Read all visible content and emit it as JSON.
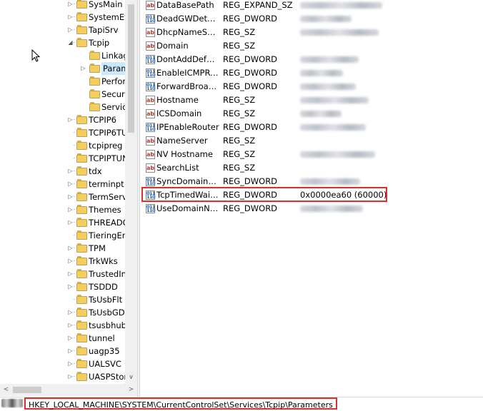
{
  "tree": {
    "items": [
      {
        "label": "SysMain",
        "indent": 0,
        "expander": "collapsed"
      },
      {
        "label": "SystemEve",
        "indent": 0,
        "expander": "collapsed"
      },
      {
        "label": "TapiSrv",
        "indent": 0,
        "expander": "collapsed"
      },
      {
        "label": "Tcpip",
        "indent": 0,
        "expander": "expanded"
      },
      {
        "label": "Linkag",
        "indent": 1,
        "expander": "none"
      },
      {
        "label": "Param",
        "indent": 1,
        "expander": "collapsed",
        "selected": true
      },
      {
        "label": "Perfor",
        "indent": 1,
        "expander": "none"
      },
      {
        "label": "Securit",
        "indent": 1,
        "expander": "none"
      },
      {
        "label": "Service",
        "indent": 1,
        "expander": "none"
      },
      {
        "label": "TCPIP6",
        "indent": 0,
        "expander": "collapsed"
      },
      {
        "label": "TCPIP6TU",
        "indent": 0,
        "expander": "none"
      },
      {
        "label": "tcpipreg",
        "indent": 0,
        "expander": "none"
      },
      {
        "label": "TCPIPTUN",
        "indent": 0,
        "expander": "none"
      },
      {
        "label": "tdx",
        "indent": 0,
        "expander": "collapsed"
      },
      {
        "label": "terminpt",
        "indent": 0,
        "expander": "collapsed"
      },
      {
        "label": "TermServi",
        "indent": 0,
        "expander": "collapsed"
      },
      {
        "label": "Themes",
        "indent": 0,
        "expander": "collapsed"
      },
      {
        "label": "THREADO",
        "indent": 0,
        "expander": "collapsed"
      },
      {
        "label": "TieringEng",
        "indent": 0,
        "expander": "none"
      },
      {
        "label": "TPM",
        "indent": 0,
        "expander": "collapsed"
      },
      {
        "label": "TrkWks",
        "indent": 0,
        "expander": "collapsed"
      },
      {
        "label": "TrustedIns",
        "indent": 0,
        "expander": "collapsed"
      },
      {
        "label": "TSDDD",
        "indent": 0,
        "expander": "collapsed"
      },
      {
        "label": "TsUsbFlt",
        "indent": 0,
        "expander": "none"
      },
      {
        "label": "TsUsbGD",
        "indent": 0,
        "expander": "collapsed"
      },
      {
        "label": "tsusbhub",
        "indent": 0,
        "expander": "collapsed"
      },
      {
        "label": "tunnel",
        "indent": 0,
        "expander": "collapsed"
      },
      {
        "label": "uagp35",
        "indent": 0,
        "expander": "collapsed"
      },
      {
        "label": "UALSVC",
        "indent": 0,
        "expander": "collapsed"
      },
      {
        "label": "UASPStor",
        "indent": 0,
        "expander": "collapsed"
      }
    ]
  },
  "values": [
    {
      "name": "DataBasePath",
      "type": "REG_EXPAND_SZ",
      "icon": "string-value-icon",
      "data_blurred": true
    },
    {
      "name": "DeadGWDetec...",
      "type": "REG_DWORD",
      "icon": "dword-value-icon",
      "data_blurred": true
    },
    {
      "name": "DhcpNameSer...",
      "type": "REG_SZ",
      "icon": "string-value-icon",
      "data_blurred": true
    },
    {
      "name": "Domain",
      "type": "REG_SZ",
      "icon": "string-value-icon",
      "data_blurred": false
    },
    {
      "name": "DontAddDefau...",
      "type": "REG_DWORD",
      "icon": "dword-value-icon",
      "data_blurred": true
    },
    {
      "name": "EnableICMPRe...",
      "type": "REG_DWORD",
      "icon": "dword-value-icon",
      "data_blurred": true
    },
    {
      "name": "ForwardBroad...",
      "type": "REG_DWORD",
      "icon": "dword-value-icon",
      "data_blurred": true
    },
    {
      "name": "Hostname",
      "type": "REG_SZ",
      "icon": "string-value-icon",
      "data_blurred": true
    },
    {
      "name": "ICSDomain",
      "type": "REG_SZ",
      "icon": "string-value-icon",
      "data_blurred": true
    },
    {
      "name": "IPEnableRouter",
      "type": "REG_DWORD",
      "icon": "dword-value-icon",
      "data_blurred": true
    },
    {
      "name": "NameServer",
      "type": "REG_SZ",
      "icon": "string-value-icon",
      "data_blurred": false
    },
    {
      "name": "NV Hostname",
      "type": "REG_SZ",
      "icon": "string-value-icon",
      "data_blurred": true
    },
    {
      "name": "SearchList",
      "type": "REG_SZ",
      "icon": "string-value-icon",
      "data_blurred": false
    },
    {
      "name": "SyncDomainWi...",
      "type": "REG_DWORD",
      "icon": "dword-value-icon",
      "data_blurred": true
    },
    {
      "name": "TcpTimedWait...",
      "type": "REG_DWORD",
      "icon": "dword-value-icon",
      "data": "0x0000ea60 (60000)",
      "highlighted": true
    },
    {
      "name": "UseDomainNa...",
      "type": "REG_DWORD",
      "icon": "dword-value-icon",
      "data_blurred": true
    }
  ],
  "icon_glyphs": {
    "string": "ab",
    "dword": "011\n110"
  },
  "status": {
    "path": "HKEY_LOCAL_MACHINE\\SYSTEM\\CurrentControlSet\\Services\\Tcpip\\Parameters"
  },
  "colors": {
    "highlight_border": "#d9302b",
    "selection": "#cce8ff",
    "folder": "#f3cd5d"
  }
}
